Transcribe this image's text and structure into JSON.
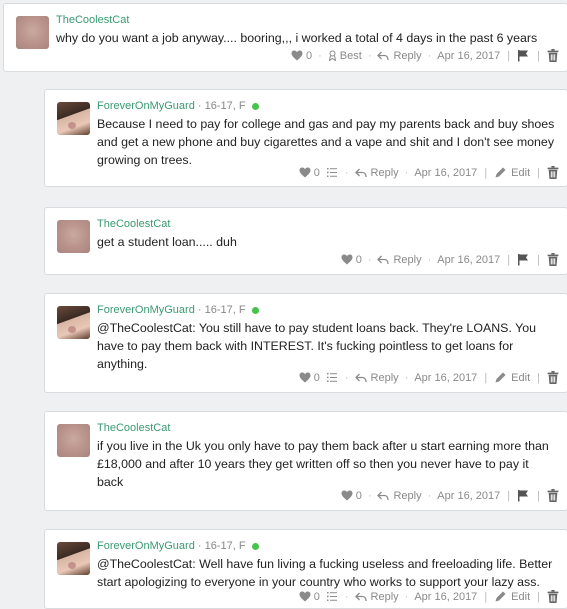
{
  "comments": [
    {
      "username": "TheCoolestCat",
      "text": "why do you want a job anyway.... booring,,, i worked a total of 4 days in the past 6 years",
      "likes": "0",
      "best_label": "Best",
      "reply_label": "Reply",
      "date": "Apr 16, 2017"
    },
    {
      "username": "ForeverOnMyGuard",
      "user_info": "· 16-17, F",
      "text": "Because I need to pay for college and gas and pay my parents back and buy shoes and get a new phone and buy cigarettes and a vape and shit and I don't see money growing on trees.",
      "likes": "0",
      "reply_label": "Reply",
      "date": "Apr 16, 2017",
      "edit_label": "Edit"
    },
    {
      "username": "TheCoolestCat",
      "text": "get a student loan..... duh",
      "likes": "0",
      "reply_label": "Reply",
      "date": "Apr 16, 2017"
    },
    {
      "username": "ForeverOnMyGuard",
      "user_info": "· 16-17, F",
      "text": "@TheCoolestCat: You still have to pay student loans back. They're LOANS. You have to pay them back with INTEREST. It's fucking pointless to get loans for anything.",
      "likes": "0",
      "reply_label": "Reply",
      "date": "Apr 16, 2017",
      "edit_label": "Edit"
    },
    {
      "username": "TheCoolestCat",
      "text": "if you live in the Uk you only have to pay them back after u start earning more than £18,000 and after 10 years they get written off so then you never have to pay it back",
      "likes": "0",
      "reply_label": "Reply",
      "date": "Apr 16, 2017"
    },
    {
      "username": "ForeverOnMyGuard",
      "user_info": "· 16-17, F",
      "text": "@TheCoolestCat: Well have fun living a fucking useless and freeloading life. Better start apologizing to everyone in your country who works to support your lazy ass.",
      "likes": "0",
      "reply_label": "Reply",
      "date": "Apr 16, 2017",
      "edit_label": "Edit"
    }
  ]
}
